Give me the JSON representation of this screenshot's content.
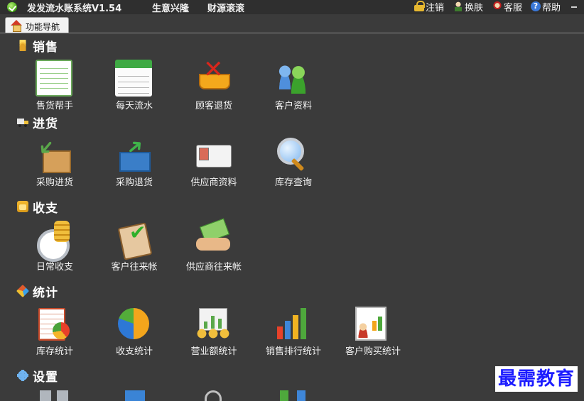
{
  "window": {
    "app_title": "发发流水账系统V1.54",
    "slogan_left": "生意兴隆",
    "slogan_right": "财源滚滚",
    "actions": [
      {
        "label": "注销",
        "icon": "lock-icon"
      },
      {
        "label": "换肤",
        "icon": "skin-icon"
      },
      {
        "label": "客服",
        "icon": "customer-service-icon"
      },
      {
        "label": "帮助",
        "icon": "help-icon"
      }
    ]
  },
  "tab": {
    "label": "功能导航",
    "icon": "home-icon"
  },
  "sections": [
    {
      "title": "销售",
      "icon": "coins-icon",
      "items": [
        {
          "label": "售货帮手",
          "icon": "sales-sheet-icon"
        },
        {
          "label": "每天流水",
          "icon": "daily-ledger-icon"
        },
        {
          "label": "顾客退货",
          "icon": "cart-return-icon"
        },
        {
          "label": "客户资料",
          "icon": "customers-icon"
        }
      ]
    },
    {
      "title": "进货",
      "icon": "truck-icon",
      "items": [
        {
          "label": "采购进货",
          "icon": "purchase-in-icon"
        },
        {
          "label": "采购退货",
          "icon": "purchase-return-icon"
        },
        {
          "label": "供应商资料",
          "icon": "supplier-card-icon"
        },
        {
          "label": "库存查询",
          "icon": "magnifier-icon"
        }
      ]
    },
    {
      "title": "收支",
      "icon": "money-bag-icon",
      "items": [
        {
          "label": "日常收支",
          "icon": "clock-coins-icon"
        },
        {
          "label": "客户往来帐",
          "icon": "clipboard-check-icon"
        },
        {
          "label": "供应商往来帐",
          "icon": "cash-handover-icon"
        }
      ]
    },
    {
      "title": "统计",
      "icon": "cube-icon",
      "items": [
        {
          "label": "库存统计",
          "icon": "report-pie-icon"
        },
        {
          "label": "收支统计",
          "icon": "pie-chart-icon"
        },
        {
          "label": "营业额统计",
          "icon": "money-chart-icon"
        },
        {
          "label": "销售排行统计",
          "icon": "bar-chart-icon"
        },
        {
          "label": "客户购买统计",
          "icon": "customer-report-icon"
        }
      ]
    },
    {
      "title": "设置",
      "icon": "gear-icon",
      "items": []
    }
  ],
  "watermark": "最需教育"
}
